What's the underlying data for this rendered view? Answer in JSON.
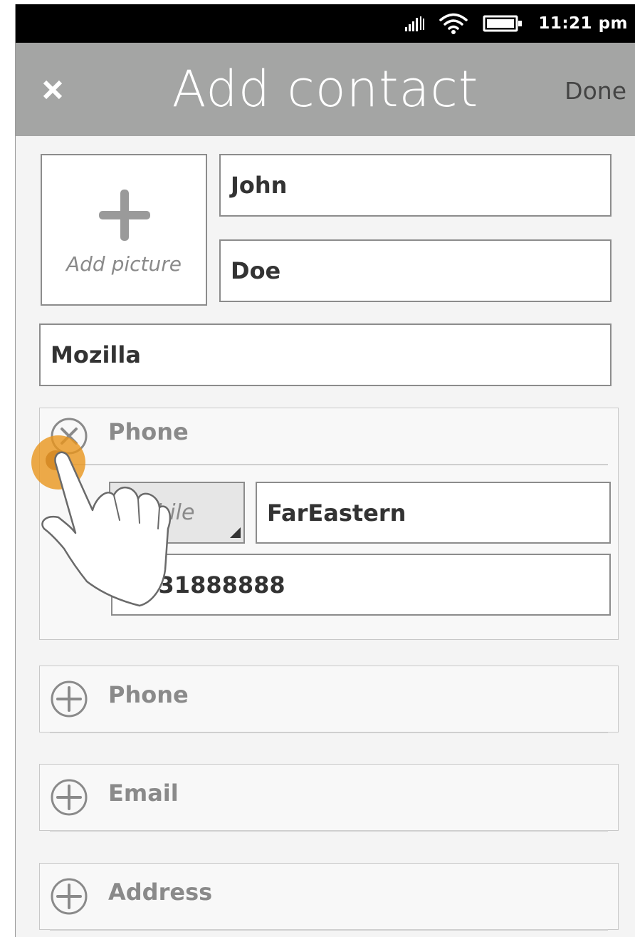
{
  "status_bar": {
    "time": "11:21 pm",
    "icons": [
      "signal-icon",
      "wifi-icon",
      "battery-icon"
    ]
  },
  "header": {
    "close_icon": "close-icon",
    "title": "Add contact",
    "done_label": "Done"
  },
  "picture": {
    "label": "Add picture",
    "icon": "plus-icon"
  },
  "form": {
    "given_name": "John",
    "family_name": "Doe",
    "company": "Mozilla"
  },
  "phone_section": {
    "label": "Phone",
    "remove_icon": "remove-icon",
    "type": "Mobile",
    "carrier": "FarEastern",
    "number": "0931888888"
  },
  "add_sections": [
    {
      "label": "Phone",
      "icon": "add-icon"
    },
    {
      "label": "Email",
      "icon": "add-icon"
    },
    {
      "label": "Address",
      "icon": "add-icon"
    }
  ],
  "colors": {
    "header_bg": "#a4a5a4",
    "status_bar_bg": "#000000",
    "touch_indicator": "#e8951c"
  }
}
